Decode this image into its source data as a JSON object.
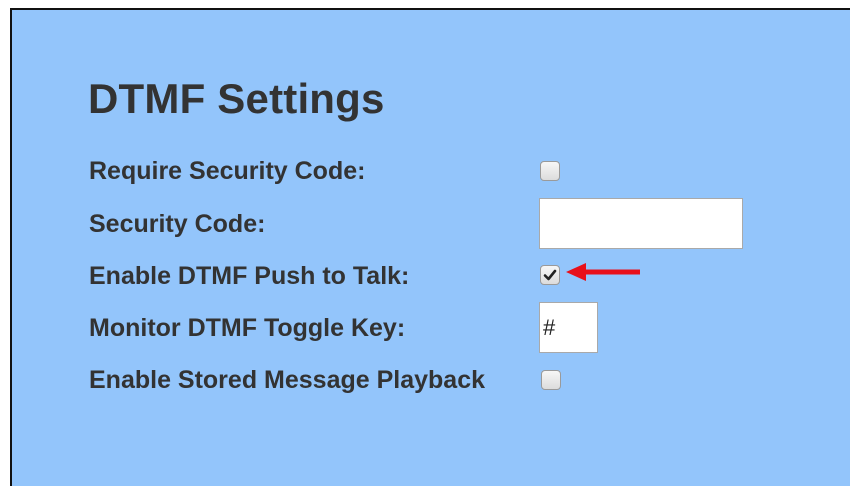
{
  "section": {
    "title": "DTMF Settings"
  },
  "fields": {
    "require_security_code": {
      "label": "Require Security Code:",
      "checked": false
    },
    "security_code": {
      "label": "Security Code:",
      "value": ""
    },
    "enable_push_to_talk": {
      "label": "Enable DTMF Push to Talk:",
      "checked": true
    },
    "monitor_toggle_key": {
      "label": "Monitor DTMF Toggle Key:",
      "value": "#"
    },
    "stored_message_playback": {
      "label": "Enable Stored Message Playback",
      "checked": false
    }
  },
  "annotation": {
    "arrow_color": "#e8101a",
    "arrow_icon": "left-arrow-icon"
  },
  "colors": {
    "panel_background": "#93c5fb",
    "text": "#333333"
  }
}
